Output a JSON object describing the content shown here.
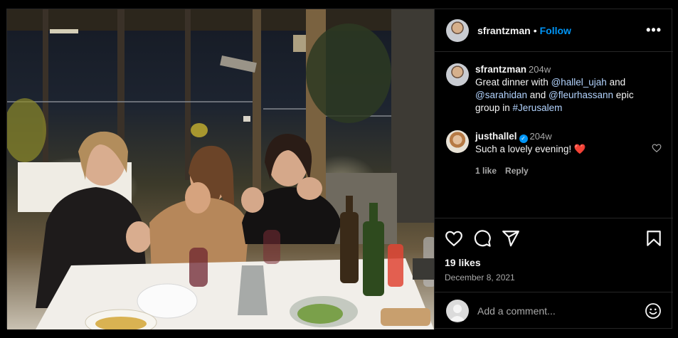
{
  "post": {
    "username": "sfrantzman",
    "separator": "•",
    "follow_label": "Follow",
    "more_label": "•••"
  },
  "caption": {
    "username": "sfrantzman",
    "time": "204w",
    "text_before": "Great dinner with ",
    "mention1": "@hallel_ujah",
    "and1": " and ",
    "mention2": "@sarahidan",
    "and2": " and ",
    "mention3": "@fleurhassann",
    "text_after": " epic group in ",
    "hashtag": "#Jerusalem"
  },
  "comment": {
    "username": "justhallel",
    "verified_mark": "✓",
    "time": "204w",
    "text": "Such a lovely evening! ",
    "emoji": "❤️",
    "likes_label": "1 like",
    "reply_label": "Reply"
  },
  "engagement": {
    "likes": "19 likes",
    "date": "December 8, 2021"
  },
  "add_comment": {
    "placeholder": "Add a comment..."
  },
  "icons": {
    "like": "heart-icon",
    "comment": "comment-icon",
    "share": "share-icon",
    "save": "bookmark-icon",
    "emoji": "emoji-icon"
  },
  "colors": {
    "background": "#000000",
    "follow": "#0095f6",
    "border": "#262626",
    "heart": "#ff3040"
  }
}
